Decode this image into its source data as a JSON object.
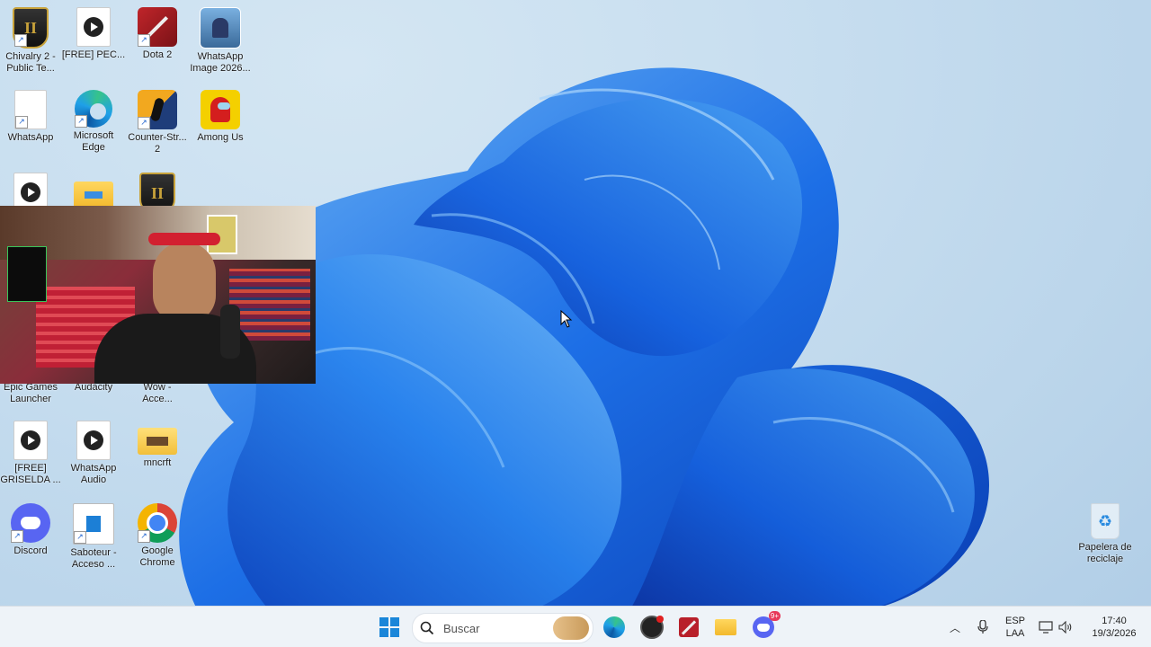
{
  "desktop": {
    "icons": [
      {
        "label": "Chivalry 2 -\nPublic Te...",
        "icon": "chivalry-shield-icon"
      },
      {
        "label": "[FREE] PEC...",
        "icon": "media-file-icon"
      },
      {
        "label": "Dota 2",
        "icon": "dota-icon"
      },
      {
        "label": "WhatsApp\nImage 2026...",
        "icon": "image-thumbnail-icon"
      },
      {
        "label": "WhatsApp",
        "icon": "blank-file-icon"
      },
      {
        "label": "Microsoft\nEdge",
        "icon": "edge-icon"
      },
      {
        "label": "Counter-Str...\n2",
        "icon": "counter-strike-icon"
      },
      {
        "label": "Among Us",
        "icon": "among-us-icon"
      },
      {
        "label": "",
        "icon": "media-file-icon"
      },
      {
        "label": "",
        "icon": "folder-icon"
      },
      {
        "label": "",
        "icon": "chivalry-shield-icon"
      },
      {
        "label": "Epic Games\nLauncher",
        "icon": "epic-games-icon"
      },
      {
        "label": "Audacity",
        "icon": "audacity-icon"
      },
      {
        "label": "Wow -\nAcce...",
        "icon": "wow-icon"
      },
      {
        "label": "[FREE]\nGRISELDA ...",
        "icon": "media-file-icon"
      },
      {
        "label": "WhatsApp\nAudio",
        "icon": "media-file-icon"
      },
      {
        "label": "mncrft",
        "icon": "folder-icon"
      },
      {
        "label": "Discord",
        "icon": "discord-icon"
      },
      {
        "label": "Saboteur -\nAcceso ...",
        "icon": "saboteur-icon"
      },
      {
        "label": "Google\nChrome",
        "icon": "chrome-icon"
      },
      {
        "label": "Papelera de\nreciclaje",
        "icon": "recycle-bin-icon"
      }
    ]
  },
  "taskbar": {
    "search_placeholder": "Buscar",
    "discord_badge": "9+",
    "language": "ESP",
    "layout": "LAA",
    "time": "17:40",
    "date": "19/3/2026"
  },
  "colors": {
    "accent": "#0067c0",
    "wallpaper_bloom": "#1e6fe0"
  }
}
